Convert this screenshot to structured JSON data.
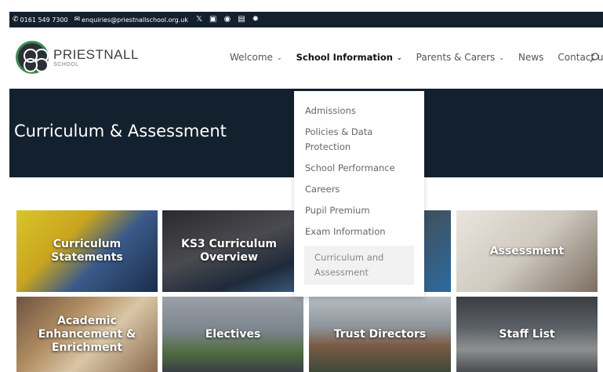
{
  "topbar": {
    "phone": "0161 549 7300",
    "email": "enquiries@priestnallschool.org.uk",
    "social_icons": [
      "x-icon",
      "instagram-icon",
      "facebook-icon",
      "camera-icon",
      "settings-icon"
    ]
  },
  "logo": {
    "name": "PRIESTNALL",
    "sub": "SCHOOL"
  },
  "nav": {
    "items": [
      {
        "label": "Welcome",
        "has_dropdown": true
      },
      {
        "label": "School Information",
        "has_dropdown": true,
        "active": true
      },
      {
        "label": "Parents & Carers",
        "has_dropdown": true
      },
      {
        "label": "News",
        "has_dropdown": false
      },
      {
        "label": "Contact us",
        "has_dropdown": false
      }
    ]
  },
  "hero": {
    "title": "Curriculum & Assessment"
  },
  "dropdown": {
    "items": [
      "Admissions",
      "Policies & Data Protection",
      "School Performance",
      "Careers",
      "Pupil Premium",
      "Exam Information",
      "Curriculum and Assessment"
    ]
  },
  "tiles": [
    {
      "label": "Curriculum Statements"
    },
    {
      "label": "KS3 Curriculum Overview"
    },
    {
      "label": ""
    },
    {
      "label": "Assessment"
    },
    {
      "label": "Academic Enhancement & Enrichment"
    },
    {
      "label": "Electives"
    },
    {
      "label": "Trust Directors"
    },
    {
      "label": "Staff List"
    }
  ],
  "colors": {
    "navy": "#13202e",
    "logo_green": "#3f8a4f",
    "white": "#ffffff"
  }
}
